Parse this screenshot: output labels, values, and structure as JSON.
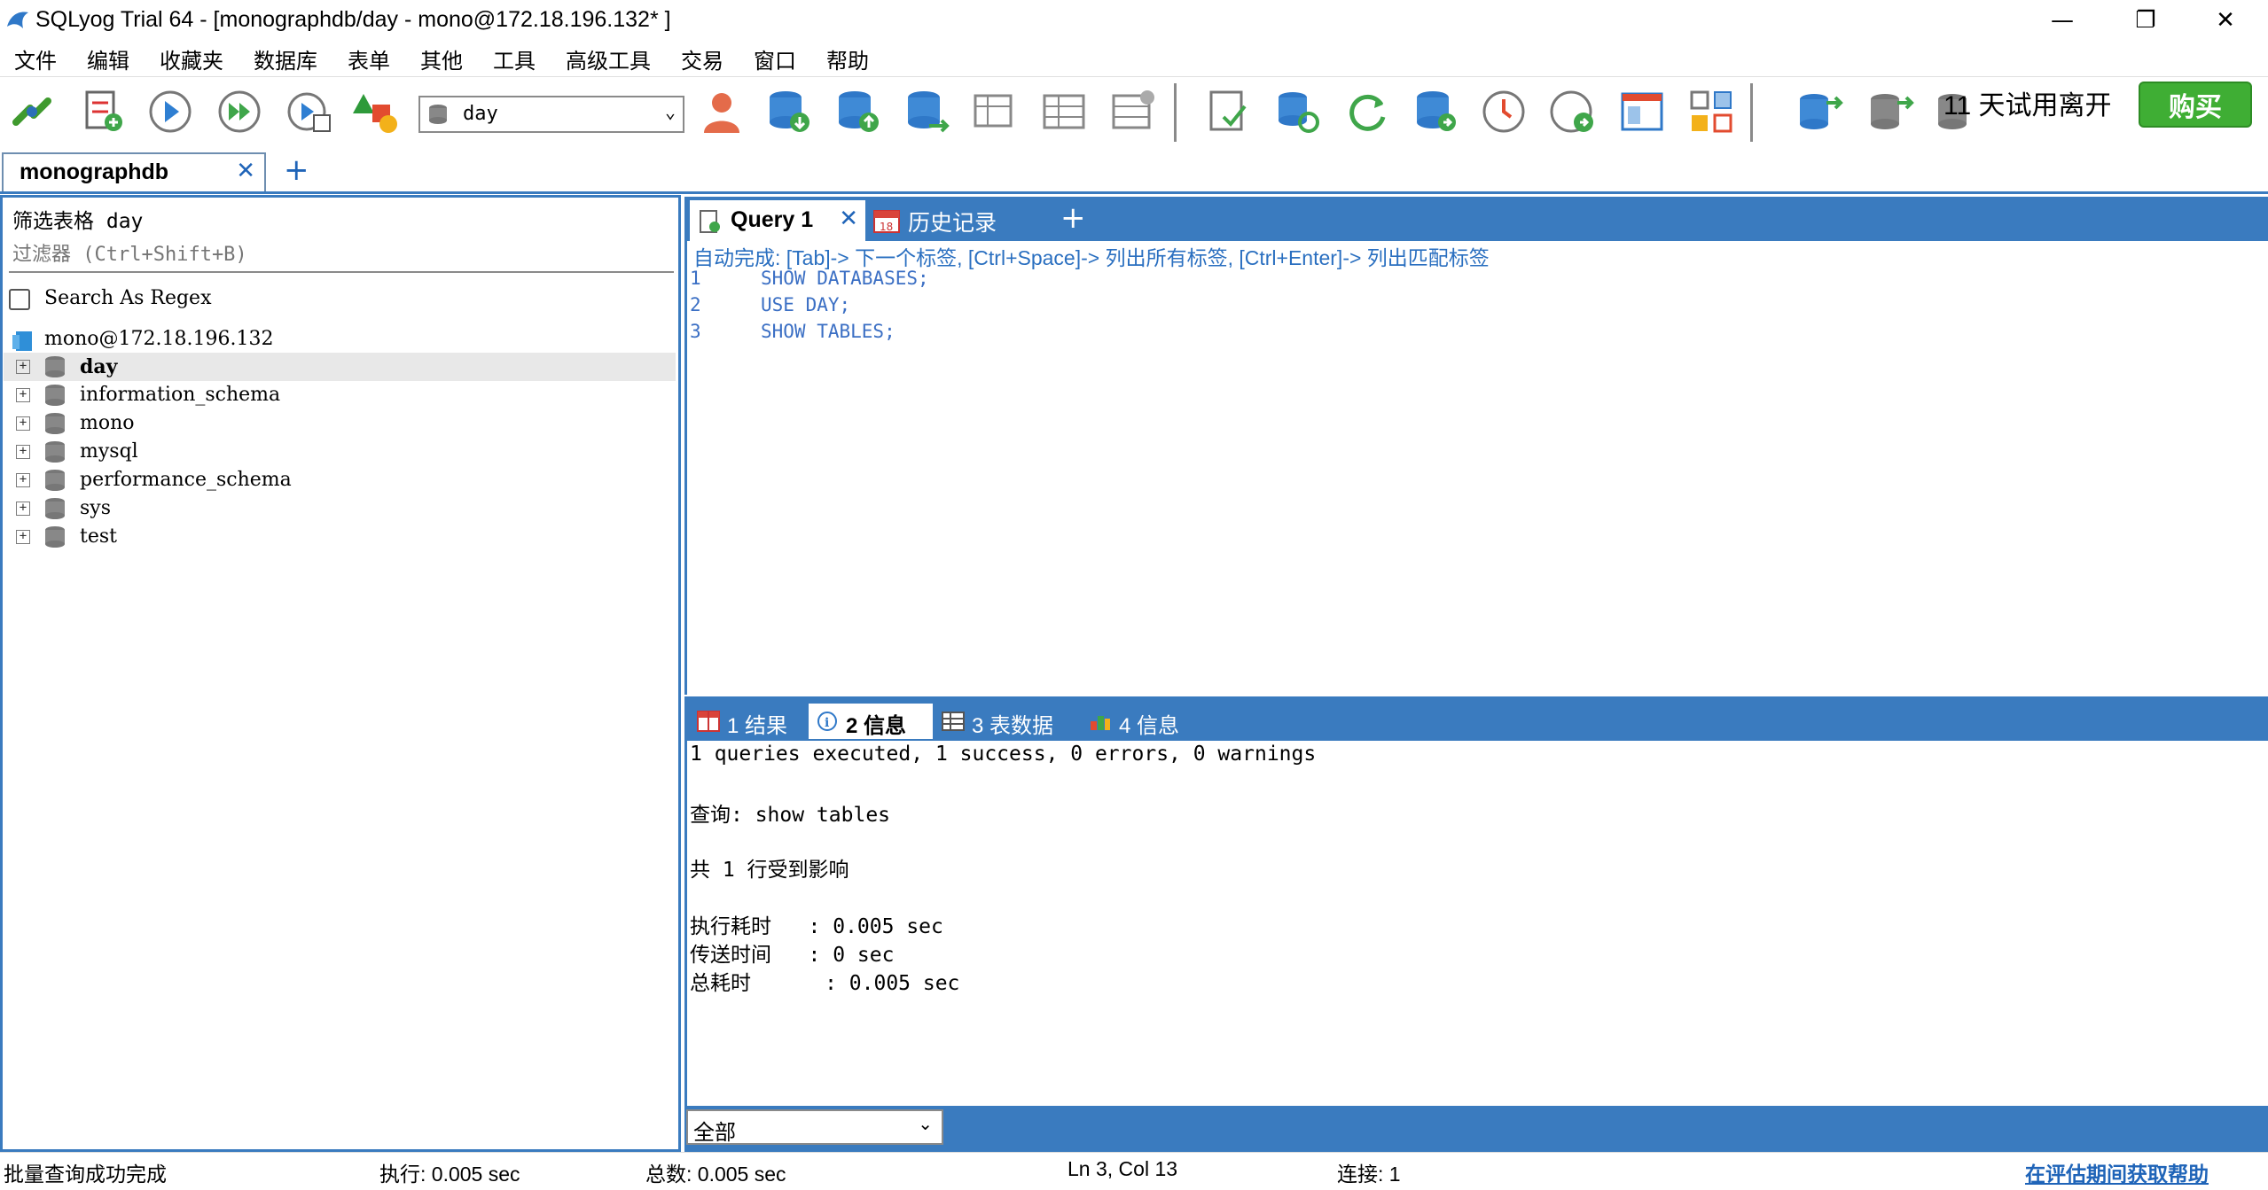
{
  "window": {
    "title": "SQLyog Trial 64 - [monographdb/day - mono@172.18.196.132* ]",
    "minimize": "—",
    "maximize": "❐",
    "close": "✕"
  },
  "menu": [
    "文件",
    "编辑",
    "收藏夹",
    "数据库",
    "表单",
    "其他",
    "工具",
    "高级工具",
    "交易",
    "窗口",
    "帮助"
  ],
  "toolbar": {
    "db_selected": "day",
    "trial_text": "11 天试用离开",
    "buy_label": "购买"
  },
  "connection_tab": {
    "label": "monographdb",
    "close": "✕",
    "add": "+"
  },
  "object_browser": {
    "filter_label": "筛选表格 day",
    "filter_placeholder": "过滤器 (Ctrl+Shift+B)",
    "regex_label": "Search As Regex",
    "host": "mono@172.18.196.132",
    "databases": [
      "day",
      "information_schema",
      "mono",
      "mysql",
      "performance_schema",
      "sys",
      "test"
    ],
    "selected": "day"
  },
  "query": {
    "tab_label": "Query 1",
    "tab_close": "✕",
    "history_label": "历史记录",
    "add_tab": "+",
    "autocomplete_hint": "自动完成: [Tab]-> 下一个标签, [Ctrl+Space]-> 列出所有标签, [Ctrl+Enter]-> 列出匹配标签",
    "lines": [
      {
        "no": "1",
        "code": "SHOW DATABASES;"
      },
      {
        "no": "2",
        "code": "USE DAY;"
      },
      {
        "no": "3",
        "code": "SHOW TABLES;"
      }
    ]
  },
  "result_tabs": [
    {
      "label": "1 结果",
      "active": false
    },
    {
      "label": "2 信息",
      "active": true
    },
    {
      "label": "3 表数据",
      "active": false
    },
    {
      "label": "4 信息",
      "active": false
    }
  ],
  "output": {
    "summary": "1 queries executed, 1 success, 0 errors, 0 warnings",
    "query_line": "查询: show tables",
    "affected": "共 1 行受到影响",
    "exec_time": "执行耗时   : 0.005 sec",
    "transfer_time": "传送时间   : 0 sec",
    "total_time": "总耗时      : 0.005 sec"
  },
  "output_filter": "全部",
  "status": {
    "message": "批量查询成功完成",
    "exec": "执行: 0.005 sec",
    "total": "总数: 0.005 sec",
    "position": "Ln 3, Col 13",
    "connections": "连接: 1",
    "help_link": "在评估期间获取帮助"
  },
  "colors": {
    "accent": "#3a7bbf",
    "buy": "#3fae34",
    "link": "#1f64b8"
  }
}
